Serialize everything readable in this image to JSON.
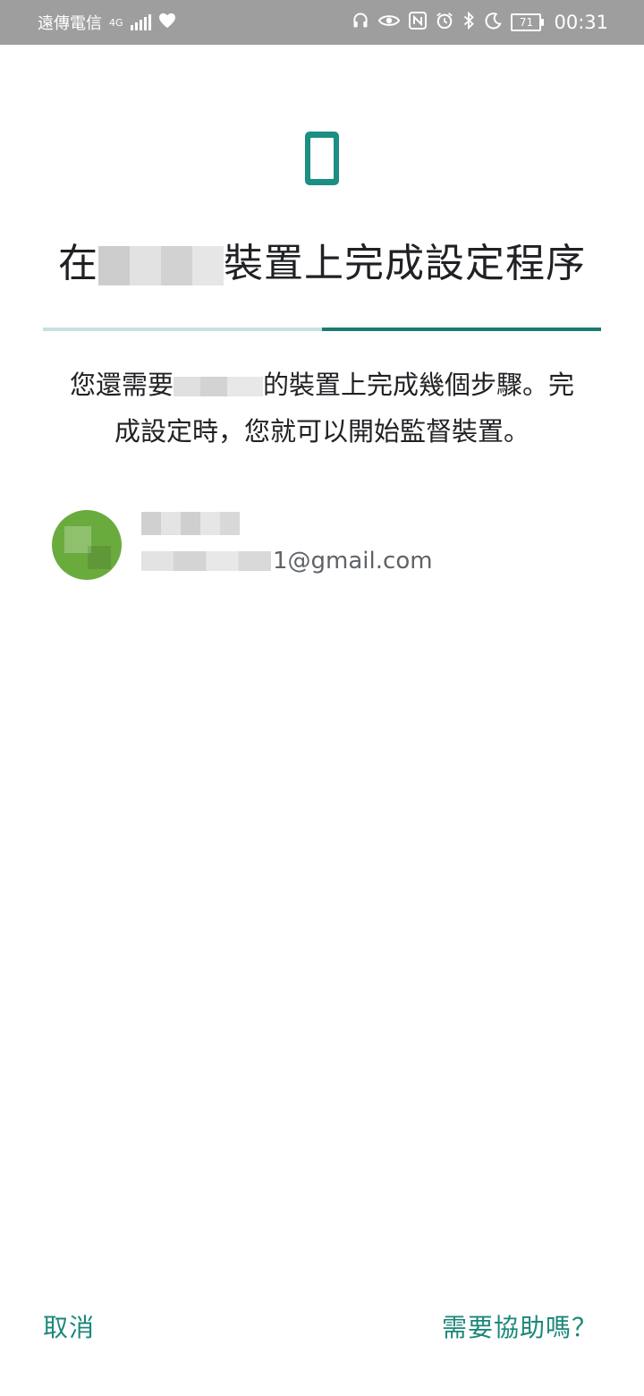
{
  "status_bar": {
    "carrier": "遠傳電信",
    "network": "4G",
    "battery": "71",
    "time": "00:31"
  },
  "header": {
    "title_prefix": "在",
    "title_suffix": "裝置上完成設定程序"
  },
  "progress": {
    "completed_fraction": 0.5
  },
  "description": {
    "line1_prefix": "您還需要",
    "line1_suffix": "的裝置上完成幾個步驟。完",
    "line2": "成設定時，您就可以開始監督裝置。"
  },
  "account": {
    "email_suffix": "1@gmail.com"
  },
  "footer": {
    "cancel_label": "取消",
    "help_label": "需要協助嗎？"
  },
  "colors": {
    "accent": "#1b8779",
    "progress_track": "#c9e0e3",
    "progress_fill": "#1b7b6f",
    "status_bar": "#9e9e9e"
  }
}
